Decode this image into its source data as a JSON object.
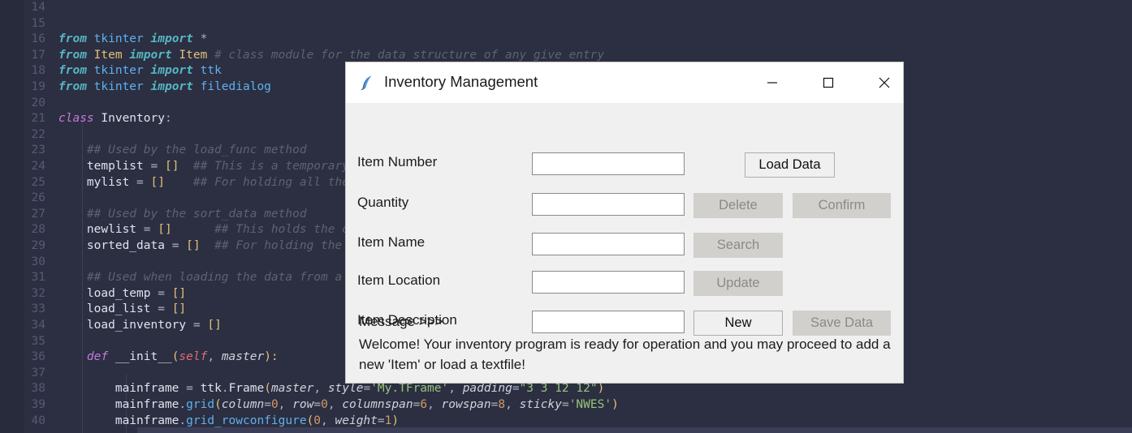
{
  "editor": {
    "language": "python",
    "lines": [
      {
        "num": "14",
        "tokens": []
      },
      {
        "num": "15",
        "tokens": []
      },
      {
        "num": "16",
        "tokens": [
          {
            "t": "from ",
            "c": "kwb"
          },
          {
            "t": "tkinter ",
            "c": "mod"
          },
          {
            "t": "import ",
            "c": "kwb"
          },
          {
            "t": "*",
            "c": "op"
          }
        ]
      },
      {
        "num": "17",
        "tokens": [
          {
            "t": "from ",
            "c": "kwb"
          },
          {
            "t": "Item ",
            "c": "cls"
          },
          {
            "t": "import ",
            "c": "kwb"
          },
          {
            "t": "Item ",
            "c": "cls"
          },
          {
            "t": "# class module for the data structure of any give entry",
            "c": "com"
          }
        ]
      },
      {
        "num": "18",
        "tokens": [
          {
            "t": "from ",
            "c": "kwb"
          },
          {
            "t": "tkinter ",
            "c": "mod"
          },
          {
            "t": "import ",
            "c": "kwb"
          },
          {
            "t": "ttk",
            "c": "mod"
          }
        ]
      },
      {
        "num": "19",
        "tokens": [
          {
            "t": "from ",
            "c": "kwb"
          },
          {
            "t": "tkinter ",
            "c": "mod"
          },
          {
            "t": "import ",
            "c": "kwb"
          },
          {
            "t": "filedialog",
            "c": "mod"
          }
        ]
      },
      {
        "num": "20",
        "tokens": []
      },
      {
        "num": "21",
        "tokens": [
          {
            "t": "class ",
            "c": "kw"
          },
          {
            "t": "Inventory",
            "c": "var"
          },
          {
            "t": ":",
            "c": "op"
          }
        ]
      },
      {
        "num": "22",
        "tokens": []
      },
      {
        "num": "23",
        "tokens": [
          {
            "t": "    ",
            "c": "op"
          },
          {
            "t": "## Used by the load_func method",
            "c": "com"
          }
        ]
      },
      {
        "num": "24",
        "tokens": [
          {
            "t": "    ",
            "c": "op"
          },
          {
            "t": "templist ",
            "c": "var"
          },
          {
            "t": "= ",
            "c": "op"
          },
          {
            "t": "[]",
            "c": "brk"
          },
          {
            "t": "  ## This is a temporary list for the load data",
            "c": "com"
          }
        ]
      },
      {
        "num": "25",
        "tokens": [
          {
            "t": "    ",
            "c": "op"
          },
          {
            "t": "mylist ",
            "c": "var"
          },
          {
            "t": "= ",
            "c": "op"
          },
          {
            "t": "[]",
            "c": "brk"
          },
          {
            "t": "    ## For holding all the data of the inventory",
            "c": "com"
          }
        ]
      },
      {
        "num": "26",
        "tokens": []
      },
      {
        "num": "27",
        "tokens": [
          {
            "t": "    ",
            "c": "op"
          },
          {
            "t": "## Used by the sort_data method",
            "c": "com"
          }
        ]
      },
      {
        "num": "28",
        "tokens": [
          {
            "t": "    ",
            "c": "op"
          },
          {
            "t": "newlist ",
            "c": "var"
          },
          {
            "t": "= ",
            "c": "op"
          },
          {
            "t": "[]",
            "c": "brk"
          },
          {
            "t": "      ## This holds the data to be sorted",
            "c": "com"
          }
        ]
      },
      {
        "num": "29",
        "tokens": [
          {
            "t": "    ",
            "c": "op"
          },
          {
            "t": "sorted_data ",
            "c": "var"
          },
          {
            "t": "= ",
            "c": "op"
          },
          {
            "t": "[]",
            "c": "brk"
          },
          {
            "t": "  ## For holding the sorted data",
            "c": "com"
          }
        ]
      },
      {
        "num": "30",
        "tokens": []
      },
      {
        "num": "31",
        "tokens": [
          {
            "t": "    ",
            "c": "op"
          },
          {
            "t": "## Used when loading the data from a textfile",
            "c": "com"
          }
        ]
      },
      {
        "num": "32",
        "tokens": [
          {
            "t": "    ",
            "c": "op"
          },
          {
            "t": "load_temp ",
            "c": "var"
          },
          {
            "t": "= ",
            "c": "op"
          },
          {
            "t": "[]",
            "c": "brk"
          }
        ]
      },
      {
        "num": "33",
        "tokens": [
          {
            "t": "    ",
            "c": "op"
          },
          {
            "t": "load_list ",
            "c": "var"
          },
          {
            "t": "= ",
            "c": "op"
          },
          {
            "t": "[]",
            "c": "brk"
          }
        ]
      },
      {
        "num": "34",
        "tokens": [
          {
            "t": "    ",
            "c": "op"
          },
          {
            "t": "load_inventory ",
            "c": "var"
          },
          {
            "t": "= ",
            "c": "op"
          },
          {
            "t": "[]",
            "c": "brk"
          }
        ]
      },
      {
        "num": "35",
        "tokens": []
      },
      {
        "num": "36",
        "tokens": [
          {
            "t": "    ",
            "c": "op"
          },
          {
            "t": "def ",
            "c": "kw"
          },
          {
            "t": "__init__",
            "c": "var"
          },
          {
            "t": "(",
            "c": "brk"
          },
          {
            "t": "self",
            "c": "self"
          },
          {
            "t": ", ",
            "c": "op"
          },
          {
            "t": "master",
            "c": "param"
          },
          {
            "t": "):",
            "c": "brk"
          }
        ]
      },
      {
        "num": "37",
        "tokens": []
      },
      {
        "num": "38",
        "tokens": [
          {
            "t": "        ",
            "c": "op"
          },
          {
            "t": "mainframe ",
            "c": "var"
          },
          {
            "t": "= ",
            "c": "op"
          },
          {
            "t": "ttk",
            "c": "var"
          },
          {
            "t": ".",
            "c": "op"
          },
          {
            "t": "Frame",
            "c": "var"
          },
          {
            "t": "(",
            "c": "brk"
          },
          {
            "t": "master",
            "c": "param"
          },
          {
            "t": ", ",
            "c": "op"
          },
          {
            "t": "style",
            "c": "param"
          },
          {
            "t": "=",
            "c": "op"
          },
          {
            "t": "'My.TFrame'",
            "c": "str"
          },
          {
            "t": ", ",
            "c": "op"
          },
          {
            "t": "padding",
            "c": "param"
          },
          {
            "t": "=",
            "c": "op"
          },
          {
            "t": "\"3 3 12 12\"",
            "c": "str"
          },
          {
            "t": ")",
            "c": "brk"
          }
        ]
      },
      {
        "num": "39",
        "tokens": [
          {
            "t": "        ",
            "c": "op"
          },
          {
            "t": "mainframe",
            "c": "var"
          },
          {
            "t": ".",
            "c": "op"
          },
          {
            "t": "grid",
            "c": "fn"
          },
          {
            "t": "(",
            "c": "brk"
          },
          {
            "t": "column",
            "c": "param"
          },
          {
            "t": "=",
            "c": "op"
          },
          {
            "t": "0",
            "c": "num"
          },
          {
            "t": ", ",
            "c": "op"
          },
          {
            "t": "row",
            "c": "param"
          },
          {
            "t": "=",
            "c": "op"
          },
          {
            "t": "0",
            "c": "num"
          },
          {
            "t": ", ",
            "c": "op"
          },
          {
            "t": "columnspan",
            "c": "param"
          },
          {
            "t": "=",
            "c": "op"
          },
          {
            "t": "6",
            "c": "num"
          },
          {
            "t": ", ",
            "c": "op"
          },
          {
            "t": "rowspan",
            "c": "param"
          },
          {
            "t": "=",
            "c": "op"
          },
          {
            "t": "8",
            "c": "num"
          },
          {
            "t": ", ",
            "c": "op"
          },
          {
            "t": "sticky",
            "c": "param"
          },
          {
            "t": "=",
            "c": "op"
          },
          {
            "t": "'NWES'",
            "c": "str"
          },
          {
            "t": ")",
            "c": "brk"
          }
        ]
      },
      {
        "num": "40",
        "tokens": [
          {
            "t": "        ",
            "c": "op"
          },
          {
            "t": "mainframe",
            "c": "var"
          },
          {
            "t": ".",
            "c": "op"
          },
          {
            "t": "grid_rowconfigure",
            "c": "fn"
          },
          {
            "t": "(",
            "c": "brk"
          },
          {
            "t": "0",
            "c": "num"
          },
          {
            "t": ", ",
            "c": "op"
          },
          {
            "t": "weight",
            "c": "param"
          },
          {
            "t": "=",
            "c": "op"
          },
          {
            "t": "1",
            "c": "num"
          },
          {
            "t": ")",
            "c": "brk"
          }
        ]
      }
    ]
  },
  "dialog": {
    "title": "Inventory Management",
    "icon": "tk-feather-icon",
    "window_controls": {
      "minimize": "minimize-icon",
      "maximize": "maximize-icon",
      "close": "close-icon"
    },
    "fields": [
      {
        "label": "Item Number",
        "value": "",
        "placeholder": ""
      },
      {
        "label": "Quantity",
        "value": "",
        "placeholder": ""
      },
      {
        "label": "Item Name",
        "value": "",
        "placeholder": ""
      },
      {
        "label": "Item Location",
        "value": "",
        "placeholder": ""
      },
      {
        "label": "Item Description",
        "value": "",
        "placeholder": ""
      }
    ],
    "buttons": [
      {
        "label": "Load Data",
        "state": "enabled"
      },
      {
        "label": "Delete",
        "state": "disabled"
      },
      {
        "label": "Confirm",
        "state": "disabled"
      },
      {
        "label": "Search",
        "state": "disabled"
      },
      {
        "label": "Update",
        "state": "disabled"
      },
      {
        "label": "New",
        "state": "enabled"
      },
      {
        "label": "Save Data",
        "state": "disabled"
      }
    ],
    "message_header": "Message >>>",
    "message_body": "Welcome! Your inventory program is ready for operation and you may proceed to add a new 'Item' or load a textfile!"
  },
  "colors": {
    "editor_bg": "#2b2f41",
    "gutter_bg": "#272b3b",
    "dialog_bg": "#f0f0f0",
    "titlebar_bg": "#ffffff",
    "entry_bg": "#ffffff",
    "entry_border": "#8a8a8a",
    "btn_enabled_bg": "#f0f0f0",
    "btn_disabled_bg": "#d2d0cd",
    "btn_disabled_text": "#8a8a8a"
  }
}
